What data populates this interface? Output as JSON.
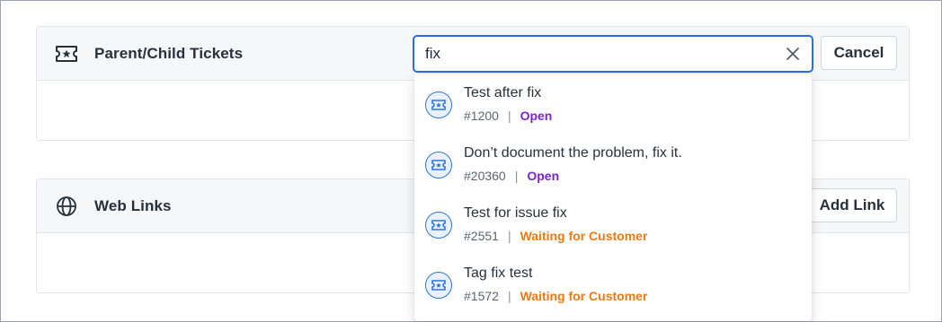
{
  "parent_child_card": {
    "title": "Parent/Child Tickets",
    "icon": "ticket-star-icon",
    "cancel_label": "Cancel"
  },
  "web_links_card": {
    "title": "Web Links",
    "icon": "globe-icon",
    "add_link_label": "Add Link"
  },
  "search": {
    "value": "fix",
    "clear_icon": "close-icon"
  },
  "results": [
    {
      "title": "Test after fix",
      "id": "#1200",
      "status": "Open",
      "status_color": "#7e22ce"
    },
    {
      "title": "Don’t document the problem, fix it.",
      "id": "#20360",
      "status": "Open",
      "status_color": "#7e22ce"
    },
    {
      "title": "Test for issue fix",
      "id": "#2551",
      "status": "Waiting for Customer",
      "status_color": "#ea7a12"
    },
    {
      "title": "Tag fix test",
      "id": "#1572",
      "status": "Waiting for Customer",
      "status_color": "#ea7a12"
    }
  ],
  "colors": {
    "accent": "#2c6fd6",
    "open": "#7e22ce",
    "waiting": "#ea7a12"
  }
}
